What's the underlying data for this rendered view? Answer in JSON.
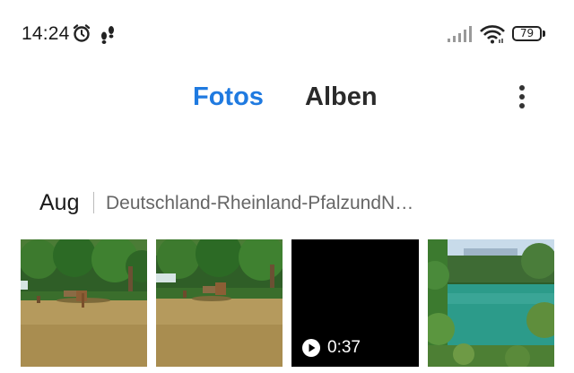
{
  "status_bar": {
    "time": "14:24",
    "battery": "79",
    "icons": [
      "alarm-icon",
      "steps-icon",
      "signal-icon",
      "wifi-icon",
      "battery-icon"
    ]
  },
  "tabs": [
    {
      "label": "Fotos",
      "active": true
    },
    {
      "label": "Alben",
      "active": false
    }
  ],
  "menu": {
    "icon": "more-vert-icon"
  },
  "section": {
    "month": "Aug",
    "location": "Deutschland-Rheinland-PfalzundN…"
  },
  "thumbnails": [
    {
      "kind": "photo",
      "subject": "deer in park"
    },
    {
      "kind": "photo",
      "subject": "deer in park"
    },
    {
      "kind": "video",
      "duration": "0:37"
    },
    {
      "kind": "photo",
      "subject": "green lake"
    }
  ],
  "colors": {
    "accent": "#1f7ae0",
    "text": "#2a2a2a",
    "muted": "#666666"
  }
}
